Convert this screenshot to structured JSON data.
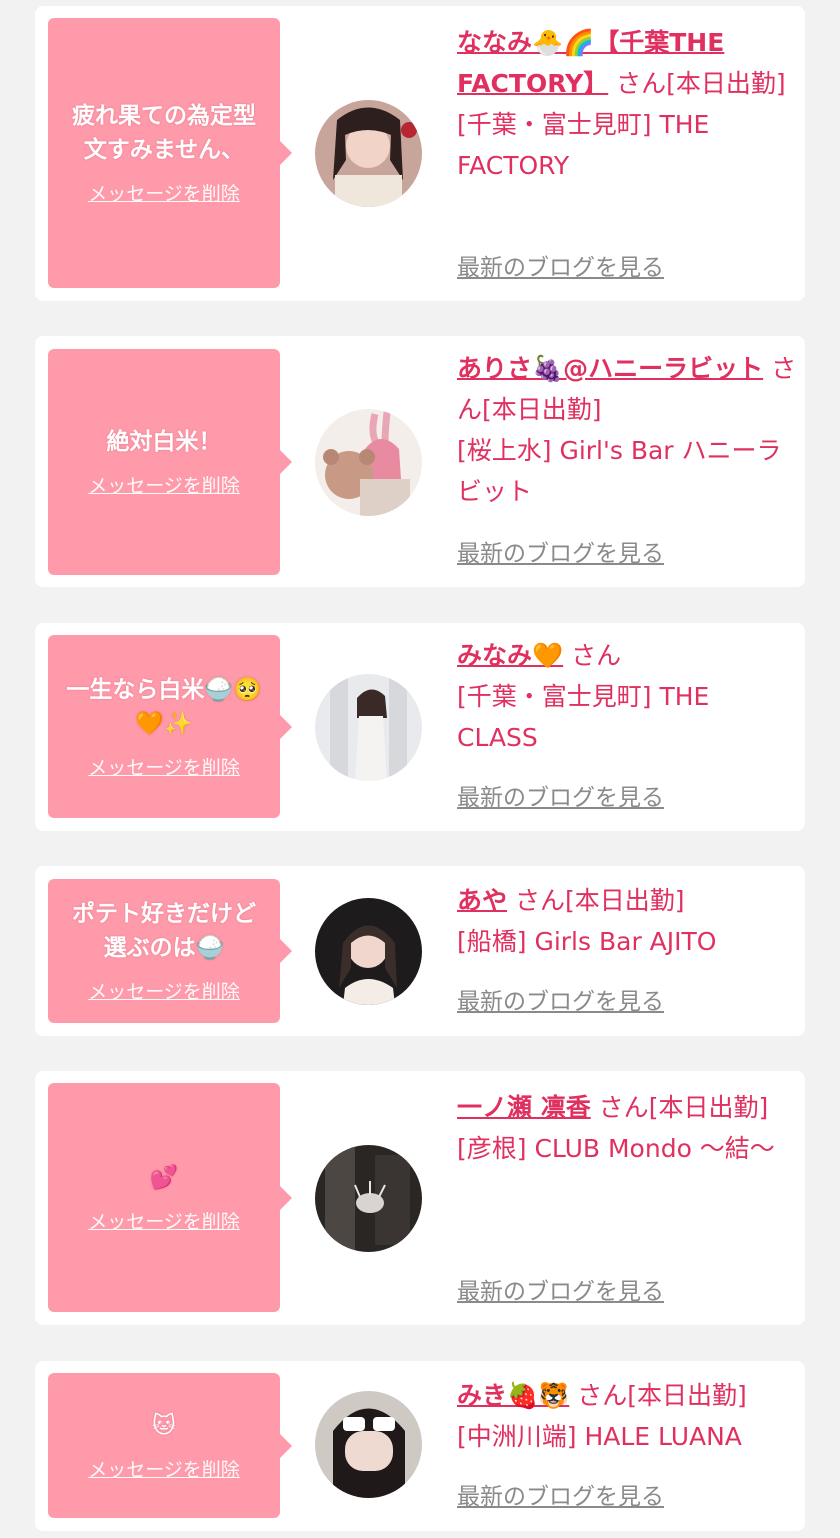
{
  "common": {
    "delete_label": "メッセージを削除",
    "blog_label": "最新のブログを見る",
    "san_label": "さん"
  },
  "cards": [
    {
      "message": "疲れ果ての為定型文すみません、",
      "name": "ななみ🐣🌈【千葉THE FACTORY】",
      "status": "[本日出勤]",
      "shop": "[千葉・富士見町] THE FACTORY",
      "avatar_icon": "profile-photo"
    },
    {
      "message": "絶対白米！",
      "name": "ありさ🍇@ハニーラビット",
      "status": "[本日出勤]",
      "shop": "[桜上水] Girl's Bar ハニーラビット",
      "avatar_icon": "profile-photo"
    },
    {
      "message": "一生なら白米🍚🥺🧡✨",
      "name": "みなみ🧡",
      "status": "",
      "shop": "[千葉・富士見町] THE CLASS",
      "avatar_icon": "profile-photo"
    },
    {
      "message": "ポテト好きだけど選ぶのは🍚",
      "name": "あや",
      "status": "[本日出勤]",
      "shop": "[船橋] Girls Bar AJITO",
      "avatar_icon": "profile-photo"
    },
    {
      "message": "💕",
      "name": "一ノ瀬 凛香",
      "status": "[本日出勤]",
      "shop": "[彦根] CLUB Mondo 〜結〜",
      "avatar_icon": "profile-photo"
    },
    {
      "message": "🐱",
      "name": "みき🍓🐯",
      "status": "[本日出勤]",
      "shop": "[中洲川端] HALE LUANA",
      "avatar_icon": "profile-photo"
    }
  ]
}
